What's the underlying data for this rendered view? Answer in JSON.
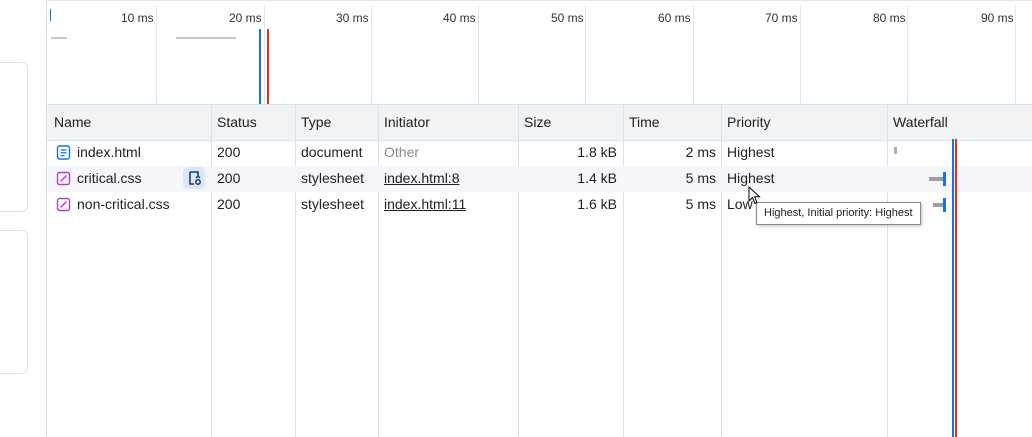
{
  "overview": {
    "ticks": [
      "10 ms",
      "20 ms",
      "30 ms",
      "40 ms",
      "50 ms",
      "60 ms",
      "70 ms",
      "80 ms",
      "90 ms"
    ]
  },
  "table": {
    "columns": [
      "Name",
      "Status",
      "Type",
      "Initiator",
      "Size",
      "Time",
      "Priority",
      "Waterfall"
    ],
    "rows": [
      {
        "name": "index.html",
        "icon": "document-icon",
        "status": "200",
        "type": "document",
        "initiator": "Other",
        "size": "1.8 kB",
        "time": "2 ms",
        "priority": "Highest"
      },
      {
        "name": "critical.css",
        "icon": "stylesheet-icon",
        "status": "200",
        "type": "stylesheet",
        "initiator": "index.html:8",
        "size": "1.4 kB",
        "time": "5 ms",
        "priority": "Highest"
      },
      {
        "name": "non-critical.css",
        "icon": "stylesheet-icon",
        "status": "200",
        "type": "stylesheet",
        "initiator": "index.html:11",
        "size": "1.6 kB",
        "time": "5 ms",
        "priority": "Low"
      }
    ]
  },
  "tooltip": {
    "text": "Highest, Initial priority: Highest"
  },
  "colors": {
    "dom_content_loaded_line": "#1a73e8",
    "load_line": "#d93025",
    "accent": "#1a73e8",
    "stylesheet_icon": "#b43fcf",
    "document_icon": "#1a73e8"
  }
}
